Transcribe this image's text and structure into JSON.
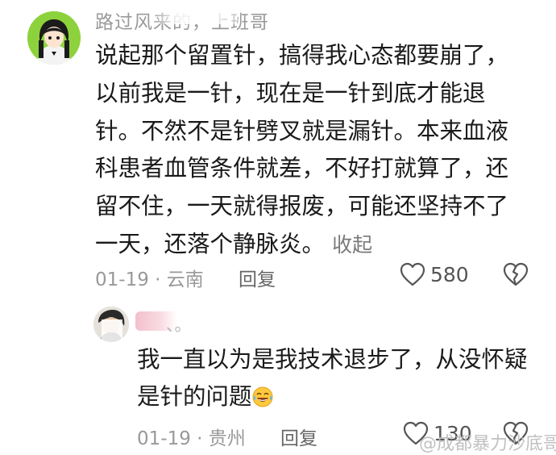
{
  "main_comment": {
    "username": "路过风来的，上班哥",
    "body": "说起那个留置针，搞得我心态都要崩了，以前我是一针，现在是一针到底才能退针。不然不是针劈叉就是漏针。本来血液科患者血管条件就差，不好打就算了，还留不住，一天就得报废，可能还坚持不了一天，还落个静脉炎。",
    "collapse_label": "收起",
    "date": "01-19",
    "separator": "·",
    "location": "云南",
    "reply_label": "回复",
    "like_count": "580"
  },
  "reply_comment": {
    "username": "、。",
    "body": "我一直以为是我技术退步了，从没怀疑是针的问题",
    "emoji": "laughing-crying-emoji",
    "date": "01-19",
    "separator": "·",
    "location": "贵州",
    "reply_label": "回复",
    "like_count": "130"
  },
  "watermark": {
    "text": "@成都暴力沙底哥"
  },
  "colors": {
    "avatar_main_bg": "#8dd23c",
    "text_primary": "#1a1a1a",
    "text_secondary": "#999999"
  }
}
